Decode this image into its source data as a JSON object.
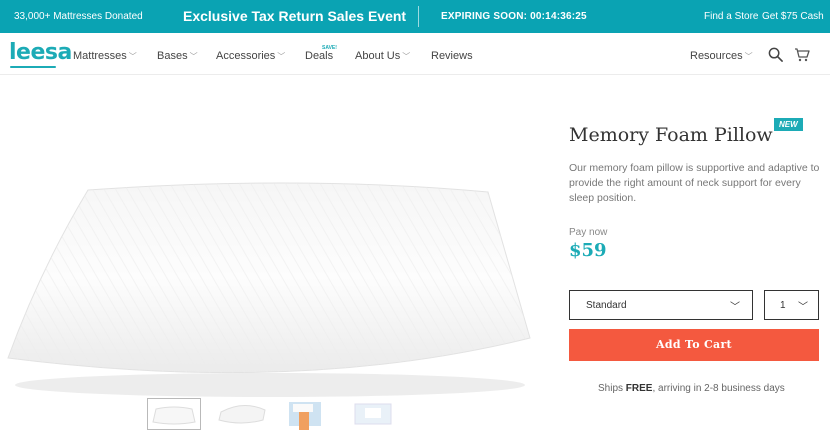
{
  "promo": {
    "donated": "33,000+ Mattresses Donated",
    "event": "Exclusive Tax Return Sales Event",
    "timer": "EXPIRING SOON: 00:14:36:25",
    "find_store": "Find a Store",
    "get_cash": "Get $75 Cash"
  },
  "nav": {
    "logo": "leesa",
    "items": [
      {
        "label": "Mattresses"
      },
      {
        "label": "Bases"
      },
      {
        "label": "Accessories"
      },
      {
        "label": "Deals"
      },
      {
        "label": "About Us"
      },
      {
        "label": "Reviews"
      }
    ],
    "save_tag": "SAVE!",
    "resources": "Resources"
  },
  "product": {
    "title": "Memory Foam Pillow",
    "badge": "NEW",
    "description": "Our memory foam pillow is supportive and adaptive to provide the right amount of neck support for every sleep position.",
    "pay_now": "Pay now",
    "price": "$59",
    "size": "Standard",
    "quantity": "1",
    "add_to_cart": "Add To Cart",
    "ships_prefix": "Ships ",
    "ships_free": "FREE",
    "ships_suffix": ", arriving in 2-8 business days"
  },
  "icons": [
    "search-icon",
    "cart-icon",
    "chevron-down-icon"
  ],
  "colors": {
    "brand": "#1cabb6",
    "promo_bar": "#0aa3b3",
    "cta": "#f4593f"
  }
}
